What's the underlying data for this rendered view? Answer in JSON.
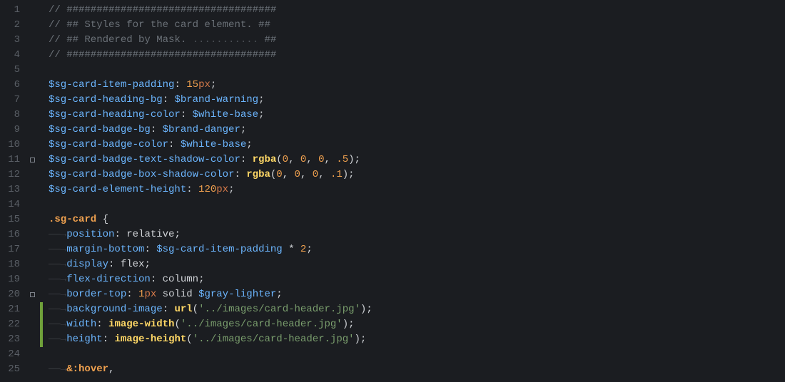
{
  "editor": {
    "lines": [
      {
        "n": 1,
        "marker": false,
        "change": false,
        "tokens": [
          {
            "t": "// ###################################",
            "c": "c-comment"
          }
        ]
      },
      {
        "n": 2,
        "marker": false,
        "change": false,
        "tokens": [
          {
            "t": "// ## Styles for the card element. ##",
            "c": "c-comment"
          }
        ]
      },
      {
        "n": 3,
        "marker": false,
        "change": false,
        "tokens": [
          {
            "t": "// ## Rendered by Mask.",
            "c": "c-comment"
          },
          {
            "t": " ........... ",
            "c": "c-dots"
          },
          {
            "t": "##",
            "c": "c-hash"
          }
        ]
      },
      {
        "n": 4,
        "marker": false,
        "change": false,
        "tokens": [
          {
            "t": "// ###################################",
            "c": "c-comment"
          }
        ]
      },
      {
        "n": 5,
        "marker": false,
        "change": false,
        "tokens": [
          {
            "t": "",
            "c": ""
          }
        ]
      },
      {
        "n": 6,
        "marker": false,
        "change": false,
        "tokens": [
          {
            "t": "$sg-card-item-padding",
            "c": "c-var"
          },
          {
            "t": ": ",
            "c": "c-punct"
          },
          {
            "t": "15",
            "c": "c-number"
          },
          {
            "t": "px",
            "c": "c-unit"
          },
          {
            "t": ";",
            "c": "c-punct"
          }
        ]
      },
      {
        "n": 7,
        "marker": false,
        "change": false,
        "tokens": [
          {
            "t": "$sg-card-heading-bg",
            "c": "c-var"
          },
          {
            "t": ": ",
            "c": "c-punct"
          },
          {
            "t": "$brand-warning",
            "c": "c-var"
          },
          {
            "t": ";",
            "c": "c-punct"
          }
        ]
      },
      {
        "n": 8,
        "marker": false,
        "change": false,
        "tokens": [
          {
            "t": "$sg-card-heading-color",
            "c": "c-var"
          },
          {
            "t": ": ",
            "c": "c-punct"
          },
          {
            "t": "$white-base",
            "c": "c-var"
          },
          {
            "t": ";",
            "c": "c-punct"
          }
        ]
      },
      {
        "n": 9,
        "marker": false,
        "change": false,
        "tokens": [
          {
            "t": "$sg-card-badge-bg",
            "c": "c-var"
          },
          {
            "t": ": ",
            "c": "c-punct"
          },
          {
            "t": "$brand-danger",
            "c": "c-var"
          },
          {
            "t": ";",
            "c": "c-punct"
          }
        ]
      },
      {
        "n": 10,
        "marker": false,
        "change": false,
        "tokens": [
          {
            "t": "$sg-card-badge-color",
            "c": "c-var"
          },
          {
            "t": ": ",
            "c": "c-punct"
          },
          {
            "t": "$white-base",
            "c": "c-var"
          },
          {
            "t": ";",
            "c": "c-punct"
          }
        ]
      },
      {
        "n": 11,
        "marker": true,
        "change": false,
        "tokens": [
          {
            "t": "$sg-card-badge-text-shadow-color",
            "c": "c-var"
          },
          {
            "t": ": ",
            "c": "c-punct"
          },
          {
            "t": "rgba",
            "c": "c-func"
          },
          {
            "t": "(",
            "c": "c-punct"
          },
          {
            "t": "0",
            "c": "c-number"
          },
          {
            "t": ", ",
            "c": "c-punct"
          },
          {
            "t": "0",
            "c": "c-number"
          },
          {
            "t": ", ",
            "c": "c-punct"
          },
          {
            "t": "0",
            "c": "c-number"
          },
          {
            "t": ", ",
            "c": "c-punct"
          },
          {
            "t": ".5",
            "c": "c-number"
          },
          {
            "t": ");",
            "c": "c-punct"
          }
        ]
      },
      {
        "n": 12,
        "marker": false,
        "change": false,
        "tokens": [
          {
            "t": "$sg-card-badge-box-shadow-color",
            "c": "c-var"
          },
          {
            "t": ": ",
            "c": "c-punct"
          },
          {
            "t": "rgba",
            "c": "c-func"
          },
          {
            "t": "(",
            "c": "c-punct"
          },
          {
            "t": "0",
            "c": "c-number"
          },
          {
            "t": ", ",
            "c": "c-punct"
          },
          {
            "t": "0",
            "c": "c-number"
          },
          {
            "t": ", ",
            "c": "c-punct"
          },
          {
            "t": "0",
            "c": "c-number"
          },
          {
            "t": ", ",
            "c": "c-punct"
          },
          {
            "t": ".1",
            "c": "c-number"
          },
          {
            "t": ");",
            "c": "c-punct"
          }
        ]
      },
      {
        "n": 13,
        "marker": false,
        "change": false,
        "tokens": [
          {
            "t": "$sg-card-element-height",
            "c": "c-var"
          },
          {
            "t": ": ",
            "c": "c-punct"
          },
          {
            "t": "120",
            "c": "c-number"
          },
          {
            "t": "px",
            "c": "c-unit"
          },
          {
            "t": ";",
            "c": "c-punct"
          }
        ]
      },
      {
        "n": 14,
        "marker": false,
        "change": false,
        "tokens": [
          {
            "t": "",
            "c": ""
          }
        ]
      },
      {
        "n": 15,
        "marker": false,
        "change": false,
        "tokens": [
          {
            "t": ".sg-card",
            "c": "c-class"
          },
          {
            "t": " {",
            "c": "c-punct"
          }
        ]
      },
      {
        "n": 16,
        "marker": false,
        "change": false,
        "tokens": [
          {
            "t": "――→",
            "c": "c-ws"
          },
          {
            "t": "position",
            "c": "c-prop"
          },
          {
            "t": ": ",
            "c": "c-punct"
          },
          {
            "t": "relative",
            "c": "c-kw"
          },
          {
            "t": ";",
            "c": "c-punct"
          }
        ]
      },
      {
        "n": 17,
        "marker": false,
        "change": false,
        "tokens": [
          {
            "t": "――→",
            "c": "c-ws"
          },
          {
            "t": "margin-bottom",
            "c": "c-prop"
          },
          {
            "t": ": ",
            "c": "c-punct"
          },
          {
            "t": "$sg-card-item-padding",
            "c": "c-var"
          },
          {
            "t": " ",
            "c": "c-punct"
          },
          {
            "t": "*",
            "c": "c-star"
          },
          {
            "t": " ",
            "c": "c-punct"
          },
          {
            "t": "2",
            "c": "c-number"
          },
          {
            "t": ";",
            "c": "c-punct"
          }
        ]
      },
      {
        "n": 18,
        "marker": false,
        "change": false,
        "tokens": [
          {
            "t": "――→",
            "c": "c-ws"
          },
          {
            "t": "display",
            "c": "c-prop"
          },
          {
            "t": ": ",
            "c": "c-punct"
          },
          {
            "t": "flex",
            "c": "c-kw"
          },
          {
            "t": ";",
            "c": "c-punct"
          }
        ]
      },
      {
        "n": 19,
        "marker": false,
        "change": false,
        "tokens": [
          {
            "t": "――→",
            "c": "c-ws"
          },
          {
            "t": "flex-direction",
            "c": "c-prop"
          },
          {
            "t": ": ",
            "c": "c-punct"
          },
          {
            "t": "column",
            "c": "c-kw"
          },
          {
            "t": ";",
            "c": "c-punct"
          }
        ]
      },
      {
        "n": 20,
        "marker": true,
        "change": false,
        "tokens": [
          {
            "t": "――→",
            "c": "c-ws"
          },
          {
            "t": "border-top",
            "c": "c-prop"
          },
          {
            "t": ": ",
            "c": "c-punct"
          },
          {
            "t": "1",
            "c": "c-number"
          },
          {
            "t": "px",
            "c": "c-unit"
          },
          {
            "t": " solid ",
            "c": "c-kw"
          },
          {
            "t": "$gray-lighter",
            "c": "c-var"
          },
          {
            "t": ";",
            "c": "c-punct"
          }
        ]
      },
      {
        "n": 21,
        "marker": false,
        "change": true,
        "tokens": [
          {
            "t": "――→",
            "c": "c-ws"
          },
          {
            "t": "background-image",
            "c": "c-prop"
          },
          {
            "t": ": ",
            "c": "c-punct"
          },
          {
            "t": "url",
            "c": "c-func"
          },
          {
            "t": "(",
            "c": "c-punct"
          },
          {
            "t": "'../images/card-header.jpg'",
            "c": "c-string"
          },
          {
            "t": ");",
            "c": "c-punct"
          }
        ]
      },
      {
        "n": 22,
        "marker": false,
        "change": true,
        "tokens": [
          {
            "t": "――→",
            "c": "c-ws"
          },
          {
            "t": "width",
            "c": "c-prop"
          },
          {
            "t": ": ",
            "c": "c-punct"
          },
          {
            "t": "image-width",
            "c": "c-func"
          },
          {
            "t": "(",
            "c": "c-punct"
          },
          {
            "t": "'../images/card-header.jpg'",
            "c": "c-string"
          },
          {
            "t": ");",
            "c": "c-punct"
          }
        ]
      },
      {
        "n": 23,
        "marker": false,
        "change": true,
        "tokens": [
          {
            "t": "――→",
            "c": "c-ws"
          },
          {
            "t": "height",
            "c": "c-prop"
          },
          {
            "t": ": ",
            "c": "c-punct"
          },
          {
            "t": "image-height",
            "c": "c-func"
          },
          {
            "t": "(",
            "c": "c-punct"
          },
          {
            "t": "'../images/card-header.jpg'",
            "c": "c-string"
          },
          {
            "t": ");",
            "c": "c-punct"
          }
        ]
      },
      {
        "n": 24,
        "marker": false,
        "change": false,
        "tokens": [
          {
            "t": "",
            "c": ""
          }
        ]
      },
      {
        "n": 25,
        "marker": false,
        "change": false,
        "tokens": [
          {
            "t": "――→",
            "c": "c-ws"
          },
          {
            "t": "&",
            "c": "c-amp"
          },
          {
            "t": ":hover",
            "c": "c-amp"
          },
          {
            "t": ",",
            "c": "c-punct"
          }
        ]
      }
    ]
  }
}
